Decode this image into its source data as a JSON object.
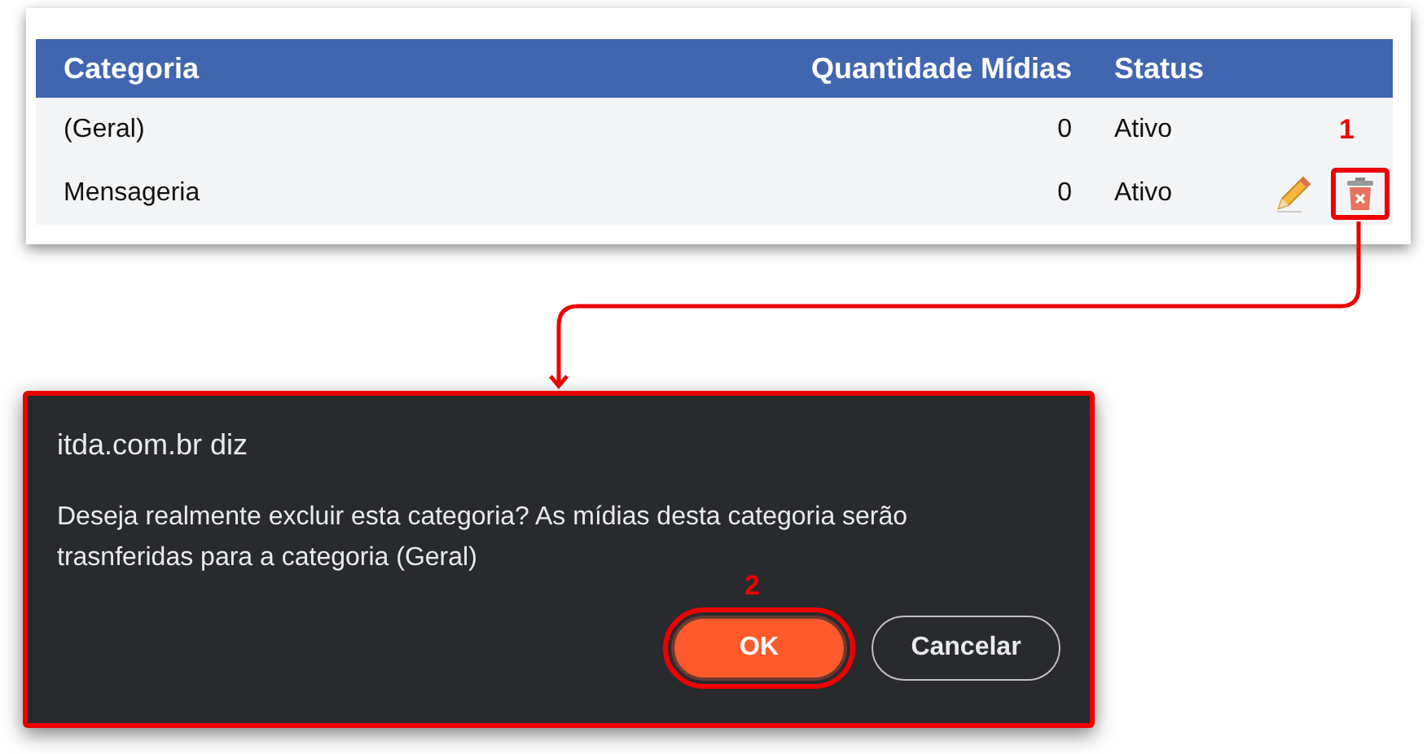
{
  "table": {
    "columns": [
      "Categoria",
      "Quantidade Mídias",
      "Status"
    ],
    "rows": [
      {
        "category": "(Geral)",
        "count": "0",
        "status": "Ativo",
        "editable": false,
        "deletable": false
      },
      {
        "category": "Mensageria",
        "count": "0",
        "status": "Ativo",
        "editable": true,
        "deletable": true
      }
    ]
  },
  "dialog": {
    "title": "itda.com.br diz",
    "message": "Deseja realmente excluir esta categoria? As mídias desta categoria serão trasnferidas para a categoria (Geral)",
    "buttons": [
      {
        "label": "OK",
        "kind": "primary"
      },
      {
        "label": "Cancelar",
        "kind": "secondary"
      }
    ]
  },
  "callouts": [
    "1",
    "2"
  ]
}
